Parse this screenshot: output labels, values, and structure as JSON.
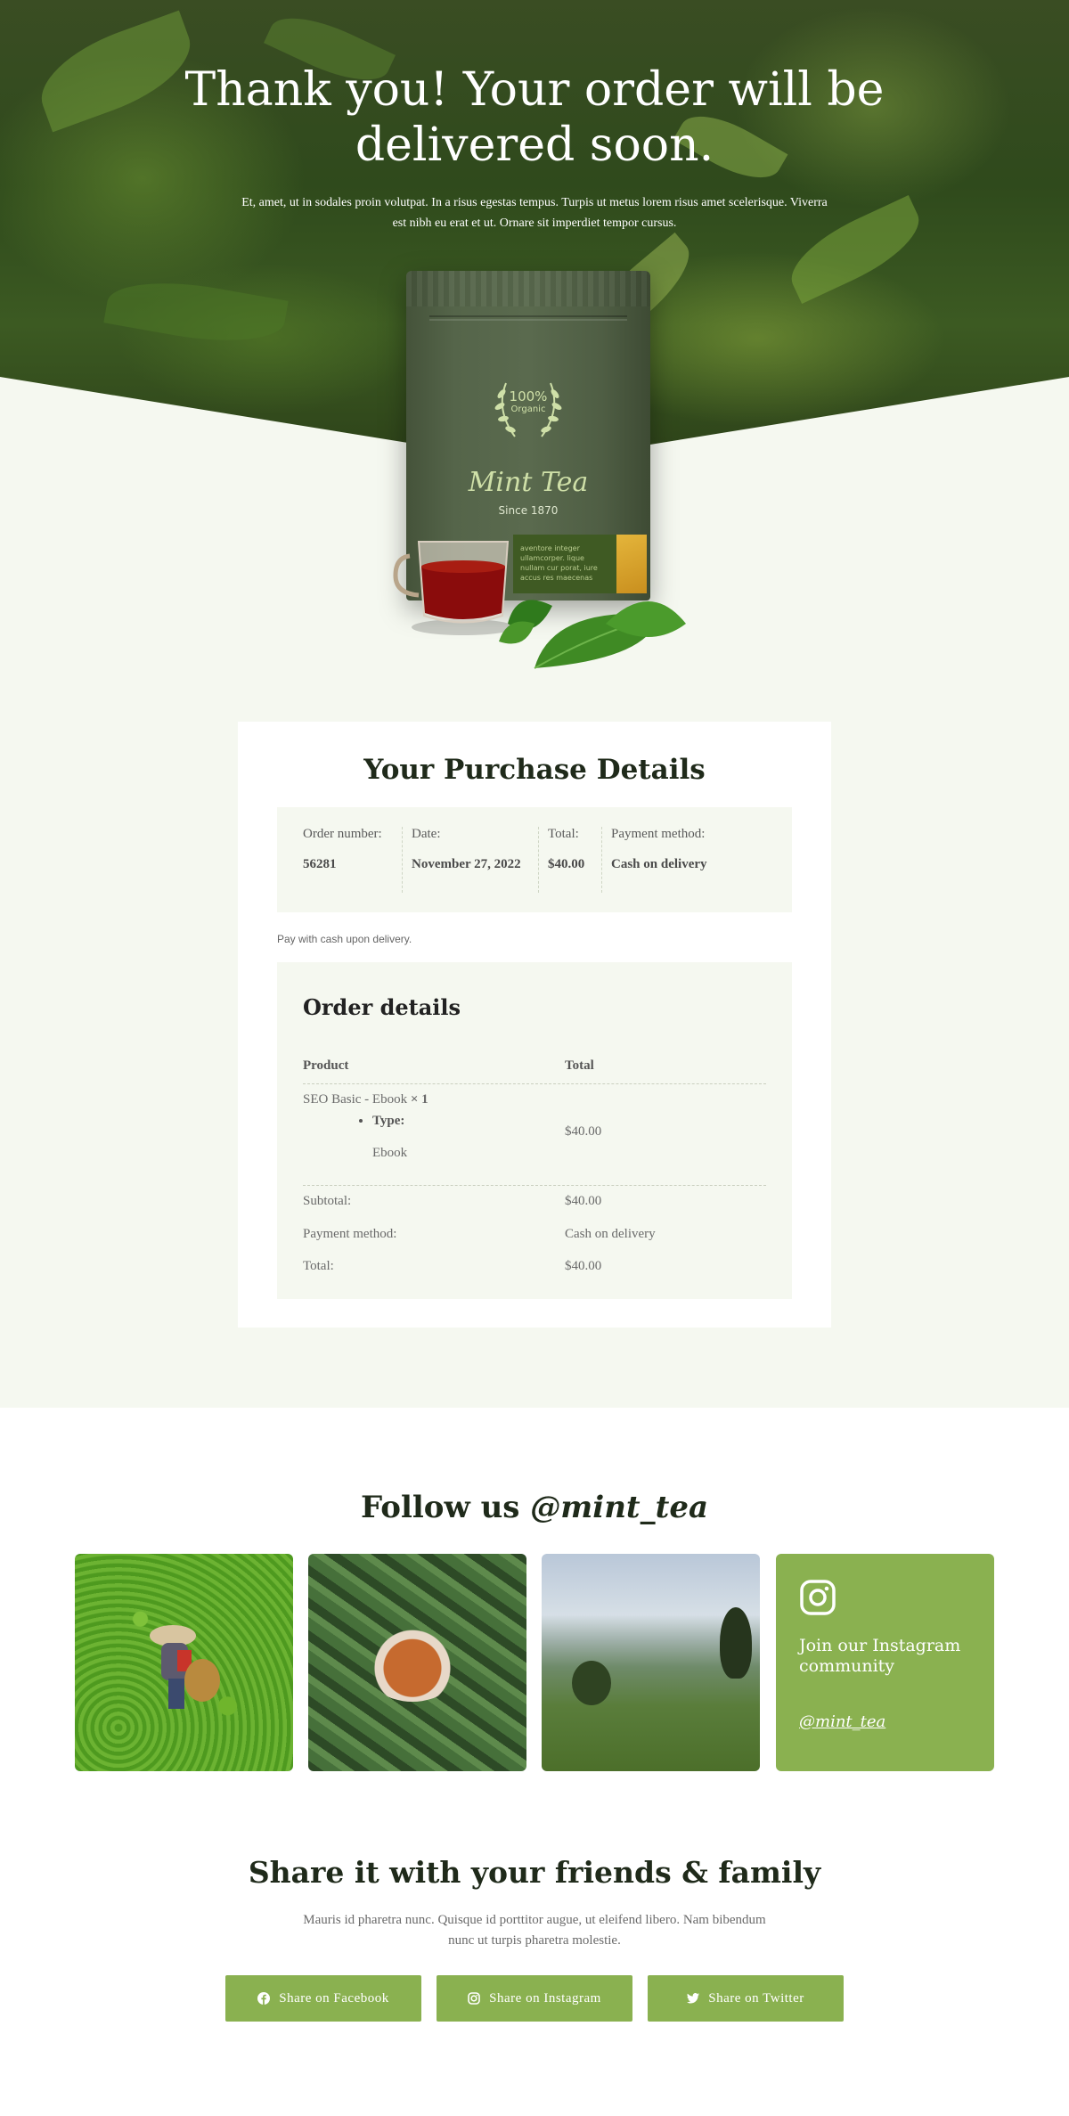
{
  "hero": {
    "title": "Thank you! Your order will be delivered soon.",
    "subtitle": "Et, amet, ut in sodales proin volutpat. In a risus egestas tempus. Turpis ut metus lorem risus amet scelerisque. Viverra est nibh eu erat et ut. Ornare sit imperdiet tempor cursus."
  },
  "package": {
    "badge_pct": "100%",
    "badge_org": "Organic",
    "brand": "Mint Tea",
    "since": "Since 1870",
    "label_text": "aventore integer ullamcorper. lique nullam cur porat, iure accus res maecenas"
  },
  "purchase": {
    "title": "Your Purchase Details",
    "summary": [
      {
        "label": "Order number:",
        "value": "56281"
      },
      {
        "label": "Date:",
        "value": "November 27, 2022"
      },
      {
        "label": "Total:",
        "value": "$40.00"
      },
      {
        "label": "Payment method:",
        "value": "Cash on delivery"
      }
    ],
    "pay_note": "Pay with cash upon delivery.",
    "details": {
      "title": "Order details",
      "head_product": "Product",
      "head_total": "Total",
      "item_name": "SEO Basic - Ebook",
      "item_qty": " × 1",
      "item_meta_label": "Type:",
      "item_meta_value": "Ebook",
      "item_total": "$40.00",
      "subtotal_label": "Subtotal:",
      "subtotal_value": "$40.00",
      "payment_label": "Payment method:",
      "payment_value": "Cash on delivery",
      "total_label": "Total:",
      "total_value": "$40.00"
    }
  },
  "follow": {
    "title_prefix": "Follow us ",
    "handle": "@mint_tea",
    "join_text": "Join our Instagram community",
    "join_handle": "@mint_tea"
  },
  "share": {
    "title": "Share it with your friends & family",
    "subtitle": "Mauris id pharetra nunc. Quisque id porttitor augue, ut eleifend libero. Nam bibendum nunc ut turpis pharetra molestie.",
    "facebook": "Share on Facebook",
    "instagram": "Share on Instagram",
    "twitter": "Share on Twitter"
  },
  "colors": {
    "accent": "#8ab150",
    "mint_bg": "#f5f8f0",
    "hero_dark": "#2f4a1c"
  }
}
